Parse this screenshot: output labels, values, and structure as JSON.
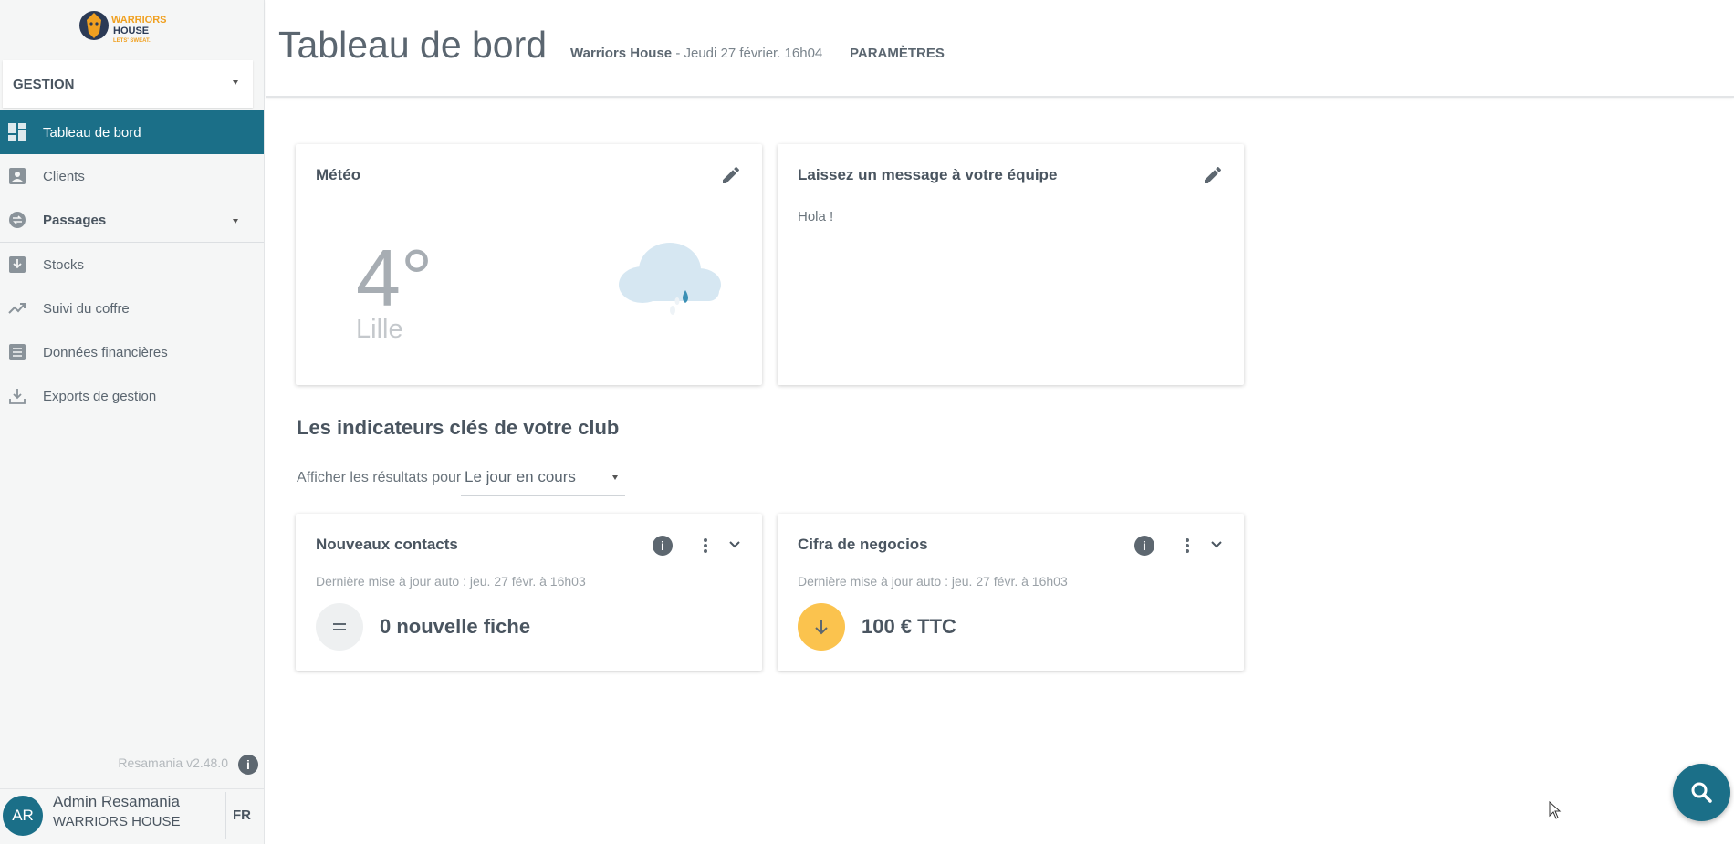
{
  "brand": {
    "logo_line1": "WARRIORS",
    "logo_line2": "HOUSE",
    "logo_tagline": "LETS' SWEAT."
  },
  "sidebar": {
    "mode": "GESTION",
    "items": [
      {
        "label": "Tableau de bord",
        "icon": "dashboard-icon",
        "active": true
      },
      {
        "label": "Clients",
        "icon": "contacts-icon"
      },
      {
        "label": "Passages",
        "icon": "passages-icon",
        "expandable": true
      },
      {
        "label": "Stocks",
        "icon": "stocks-icon"
      },
      {
        "label": "Suivi du coffre",
        "icon": "trending-up-icon"
      },
      {
        "label": "Données financières",
        "icon": "list-icon"
      },
      {
        "label": "Exports de gestion",
        "icon": "download-icon"
      }
    ],
    "version": "Resamania v2.48.0",
    "user": {
      "initials": "AR",
      "name": "Admin Resamania",
      "club": "WARRIORS HOUSE"
    },
    "language": "FR"
  },
  "header": {
    "title": "Tableau de bord",
    "club": "Warriors House",
    "date": "- Jeudi 27 février. 16h04",
    "settings_label": "PARAMÈTRES"
  },
  "weather": {
    "title": "Météo",
    "temperature": "4°",
    "city": "Lille",
    "icon": "cloud-rain-icon"
  },
  "team_message": {
    "title": "Laissez un message à votre équipe",
    "text": "Hola !"
  },
  "indicators": {
    "section_title": "Les indicateurs clés de votre club",
    "filter_label": "Afficher les résultats pour",
    "filter_value": "Le jour en cours",
    "cards": [
      {
        "title": "Nouveaux contacts",
        "updated": "Dernière mise à jour auto : jeu. 27 févr. à 16h03",
        "value": "0 nouvelle fiche",
        "trend": "equal",
        "trend_color": "#eef0f1"
      },
      {
        "title": "Cifra de negocios",
        "updated": "Dernière mise à jour auto : jeu. 27 févr. à 16h03",
        "value": "100 € TTC",
        "trend": "down",
        "trend_color": "#fbc34e"
      }
    ]
  },
  "colors": {
    "accent": "#1b6f88",
    "sidebar_bg": "#f5f6f6"
  }
}
